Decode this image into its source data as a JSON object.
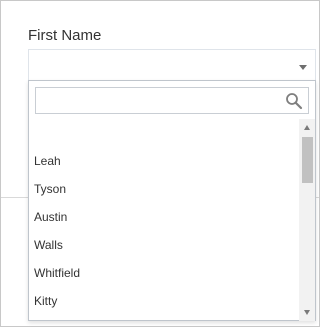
{
  "field": {
    "label": "First Name",
    "selected_value": ""
  },
  "dropdown": {
    "search": {
      "value": "",
      "placeholder": ""
    },
    "options": [
      "",
      "Leah",
      "Tyson",
      "Austin",
      "Walls",
      "Whitfield",
      "Kitty"
    ],
    "scroll_position": 0.05
  },
  "icons": {
    "search": "search-icon",
    "caret": "chevron-down-icon"
  },
  "colors": {
    "text": "#333333",
    "border": "#bfc5cc",
    "scroll_thumb": "#c1c1c1"
  }
}
